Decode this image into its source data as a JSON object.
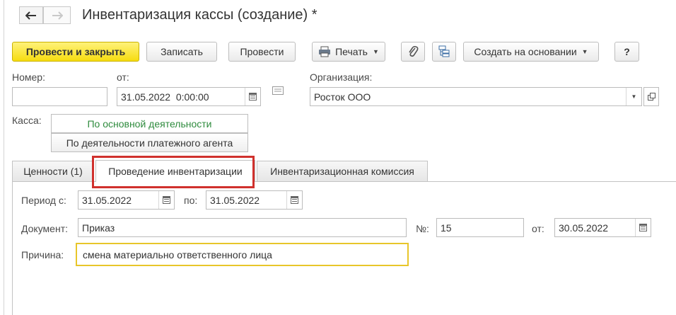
{
  "window": {
    "title": "Инвентаризация кассы (создание) *"
  },
  "nav": {
    "back_icon": "arrow-left",
    "forward_icon": "arrow-right"
  },
  "toolbar": {
    "post_close_label": "Провести и закрыть",
    "save_label": "Записать",
    "post_label": "Провести",
    "print_label": "Печать",
    "create_based_label": "Создать на основании",
    "help_label": "?"
  },
  "header": {
    "number_label": "Номер:",
    "number_value": "",
    "date_label": "от:",
    "date_value": "31.05.2022  0:00:00",
    "org_label": "Организация:",
    "org_value": "Росток ООО"
  },
  "cash": {
    "label": "Касса:",
    "options": [
      "По основной деятельности",
      "По деятельности платежного агента"
    ],
    "selected": "По основной деятельности"
  },
  "tabs": [
    {
      "label": "Ценности (1)",
      "active": false
    },
    {
      "label": "Проведение инвентаризации",
      "active": true
    },
    {
      "label": "Инвентаризационная комиссия",
      "active": false
    }
  ],
  "form": {
    "period_from_label": "Период с:",
    "period_from": "31.05.2022",
    "period_to_label": "по:",
    "period_to": "31.05.2022",
    "document_label": "Документ:",
    "document_value": "Приказ",
    "number_label": "№:",
    "number_value": "15",
    "from_label": "от:",
    "from_value": "30.05.2022",
    "reason_label": "Причина:",
    "reason_value": "смена материально ответственного лица"
  },
  "colors": {
    "primary_button": "#f6dc10",
    "highlight": "#d0312d",
    "active_option": "#2e8b3d",
    "focus_border": "#e8c62a"
  }
}
